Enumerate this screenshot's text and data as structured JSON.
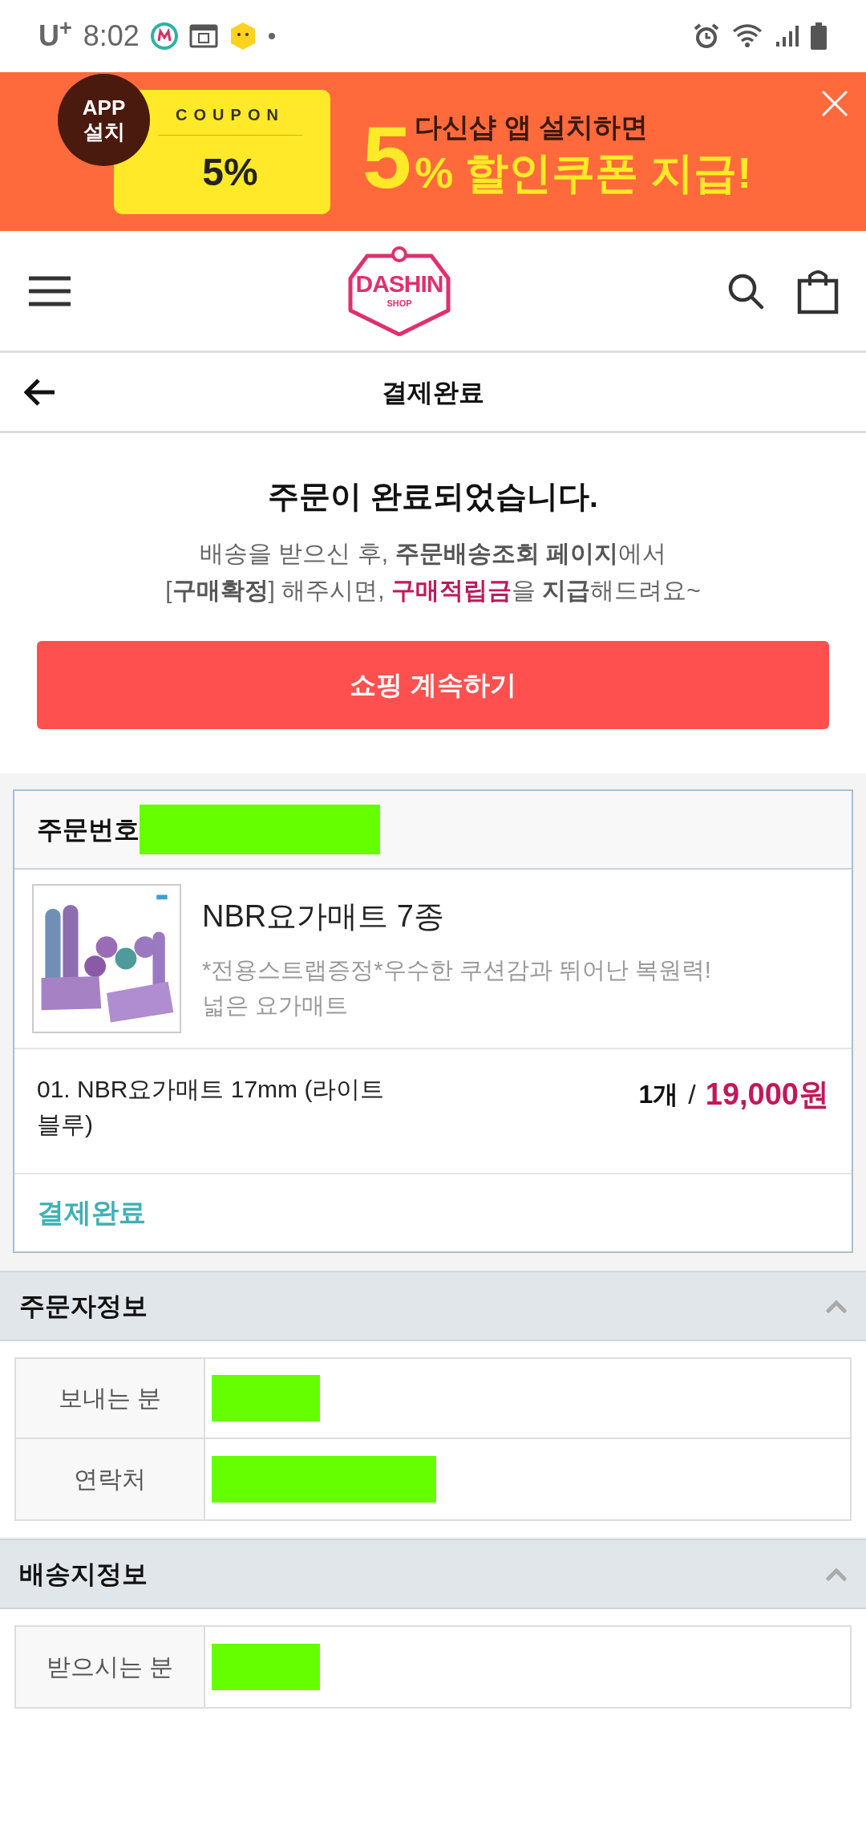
{
  "status_bar": {
    "carrier": "U$^{+}$",
    "time": "8:02"
  },
  "banner": {
    "badge": [
      "APP",
      "설치"
    ],
    "coupon_label": "COUPON",
    "coupon_value": "5%",
    "line_1": "다신샵 앱 설치하면",
    "big_digit": "5",
    "line_2": "% 할인쿠폰 지급!"
  },
  "header": {
    "logo": {
      "name": "DASHIN",
      "sub": "SHOP"
    }
  },
  "page_title": "결제완료",
  "completion": {
    "heading": "주문이 완료되었습니다.",
    "message_lines": [
      [
        {
          "text": "배송을 받으신 후, ",
          "kind": "plain"
        },
        {
          "text": "주문배송조회 페이지",
          "kind": "bold"
        },
        {
          "text": "에서",
          "kind": "plain"
        }
      ],
      [
        {
          "text": "[",
          "kind": "plain"
        },
        {
          "text": "구매확정",
          "kind": "bold"
        },
        {
          "text": "] 해주시면, ",
          "kind": "plain"
        },
        {
          "text": "구매적립금",
          "kind": "accent"
        },
        {
          "text": "을 ",
          "kind": "plain"
        },
        {
          "text": "지급",
          "kind": "bold"
        },
        {
          "text": "해드려요~",
          "kind": "plain"
        }
      ]
    ],
    "button": "쇼핑 계속하기"
  },
  "order": {
    "number_label": "주문번호",
    "product": {
      "name": "NBR요가매트 7종",
      "description": "*전용스트랩증정*우수한 쿠션감과 뛰어난 복원력! 넓은 요가매트"
    },
    "option": "01. NBR요가매트 17mm (라이트 블루)",
    "quantity": "1개",
    "separator": "/",
    "price": "19,000원",
    "status": "결제완료"
  },
  "sections": [
    {
      "title": "주문자정보",
      "expanded": true,
      "rows": [
        {
          "label": "보내는 분",
          "kind": "short"
        },
        {
          "label": "연락처",
          "kind": "long"
        }
      ]
    },
    {
      "title": "배송지정보",
      "expanded": true,
      "rows": [
        {
          "label": "받으시는 분",
          "kind": "short"
        }
      ]
    }
  ]
}
